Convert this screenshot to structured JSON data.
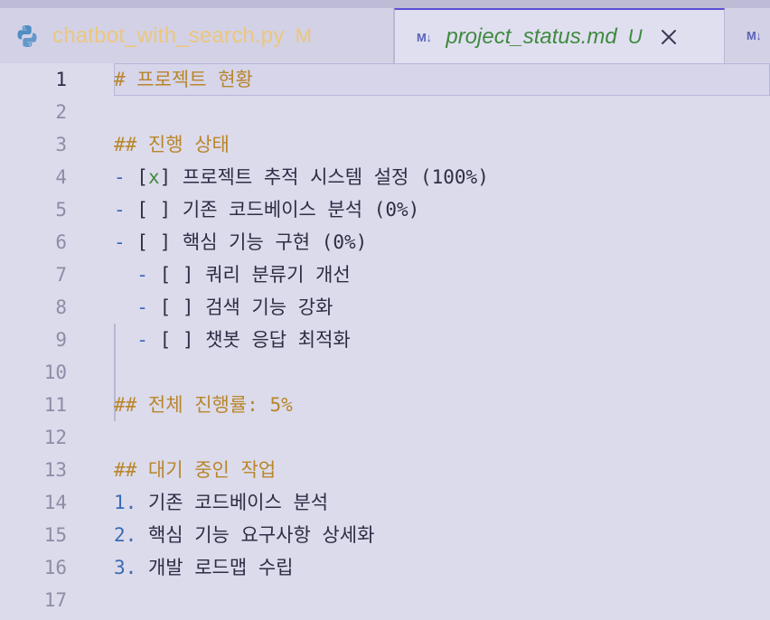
{
  "tabs": [
    {
      "title": "chatbot_with_search.py",
      "status": "M",
      "icon": "python-icon",
      "active": false
    },
    {
      "badge": "M↓",
      "title": "project_status.md",
      "status": "U",
      "icon": "markdown-icon",
      "active": true
    },
    {
      "badge": "M↓",
      "icon": "markdown-icon",
      "active": false
    }
  ],
  "editor": {
    "current_line": 1,
    "lines": [
      {
        "n": "1",
        "heading": "# 프로젝트 현황"
      },
      {
        "n": "2"
      },
      {
        "n": "3",
        "heading": "## 진행 상태"
      },
      {
        "n": "4",
        "dash": "-",
        "pre": " [",
        "mark": "x",
        "post": "] 프로젝트 추적 시스템 설정 (100%)"
      },
      {
        "n": "5",
        "dash": "-",
        "pre": " [",
        "mark": " ",
        "post": "] 기존 코드베이스 분석 (0%)"
      },
      {
        "n": "6",
        "dash": "-",
        "pre": " [",
        "mark": " ",
        "post": "] 핵심 기능 구현 (0%)"
      },
      {
        "n": "7",
        "indent": "  ",
        "dash": "-",
        "pre": " [",
        "mark": " ",
        "post": "] 쿼리 분류기 개선"
      },
      {
        "n": "8",
        "indent": "  ",
        "dash": "-",
        "pre": " [",
        "mark": " ",
        "post": "] 검색 기능 강화"
      },
      {
        "n": "9",
        "indent": "  ",
        "dash": "-",
        "pre": " [",
        "mark": " ",
        "post": "] 챗봇 응답 최적화"
      },
      {
        "n": "10"
      },
      {
        "n": "11",
        "heading": "## 전체 진행률: 5%"
      },
      {
        "n": "12"
      },
      {
        "n": "13",
        "heading": "## 대기 중인 작업"
      },
      {
        "n": "14",
        "num": "1.",
        "text": " 기존 코드베이스 분석"
      },
      {
        "n": "15",
        "num": "2.",
        "text": " 핵심 기능 요구사항 상세화"
      },
      {
        "n": "16",
        "num": "3.",
        "text": " 개발 로드맵 수립"
      },
      {
        "n": "17"
      }
    ]
  },
  "colors": {
    "background": "#dcdbeb",
    "heading": "#b8862b",
    "list_marker": "#3a6ab5",
    "checked": "#3f8a3f",
    "modified": "#ebc77e",
    "untracked": "#3f8a3f",
    "active_tab_border": "#5a4fd0"
  }
}
